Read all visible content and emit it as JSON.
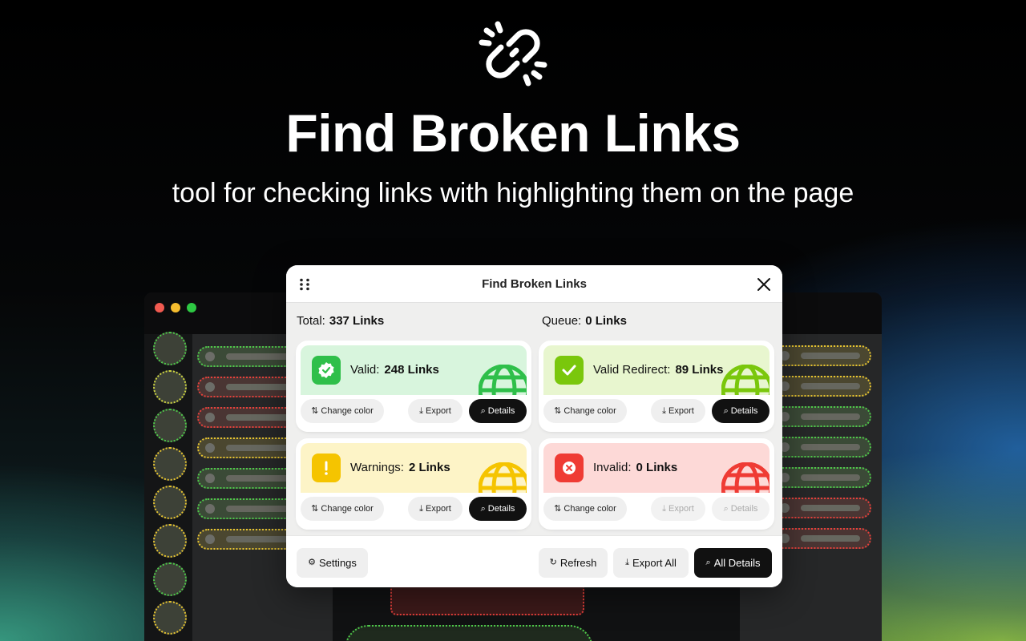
{
  "hero": {
    "title": "Find Broken Links",
    "subtitle": "tool for checking links with highlighting them on the page"
  },
  "popup": {
    "title": "Find Broken Links",
    "total_label": "Total:",
    "total_value": "337 Links",
    "queue_label": "Queue:",
    "queue_value": "0 Links",
    "cards": [
      {
        "label": "Valid:",
        "value": "248 Links",
        "color": "#2fbf4a",
        "bg": "#d8f5dd",
        "change": "Change color",
        "export": "Export",
        "details": "Details"
      },
      {
        "label": "Valid Redirect:",
        "value": "89 Links",
        "color": "#7ac70c",
        "bg": "#e8f6cf",
        "change": "Change color",
        "export": "Export",
        "details": "Details"
      },
      {
        "label": "Warnings:",
        "value": "2 Links",
        "color": "#f5c400",
        "bg": "#fdf4c7",
        "change": "Change color",
        "export": "Export",
        "details": "Details"
      },
      {
        "label": "Invalid:",
        "value": "0 Links",
        "color": "#ef3b34",
        "bg": "#fdd9d7",
        "change": "Change color",
        "export": "Export",
        "details": "Details"
      }
    ],
    "footer": {
      "settings": "Settings",
      "refresh": "Refresh",
      "export_all": "Export All",
      "all_details": "All Details"
    }
  },
  "icons": {
    "logo": "broken-link-icon",
    "drag": "drag-handle-icon",
    "close": "close-icon"
  }
}
